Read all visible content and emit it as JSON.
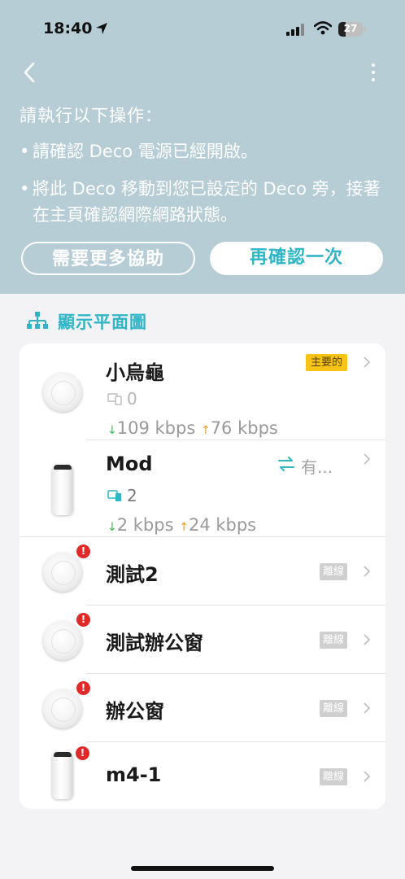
{
  "status_bar": {
    "time": "18:40",
    "battery": "27"
  },
  "header": {
    "back_icon": "chevron-left-icon",
    "menu_icon": "more-vertical-icon"
  },
  "instructions": {
    "title": "請執行以下操作：",
    "bullets": [
      "請確認 Deco 電源已經開啟。",
      "將此 Deco 移動到您已設定的 Deco 旁，接著在主頁確認網際網路狀態。"
    ],
    "bullet_marker": "•"
  },
  "buttons": {
    "help": "需要更多協助",
    "retry": "再確認一次"
  },
  "floorplan": {
    "label": "顯示平面圖",
    "icon": "network-tree-icon"
  },
  "devices": [
    {
      "name": "小烏龜",
      "badge": "主要的",
      "clients": "0",
      "down": "109 kbps",
      "up": "76 kbps",
      "type": "round",
      "online": true
    },
    {
      "name": "Mod",
      "status": "有...",
      "clients": "2",
      "down": "2 kbps",
      "up": "24 kbps",
      "type": "tower",
      "online": true
    },
    {
      "name": "測試2",
      "badge": "離線",
      "type": "round",
      "online": false
    },
    {
      "name": "測試辦公窗",
      "badge": "離線",
      "type": "round",
      "online": false
    },
    {
      "name": "辦公窗",
      "badge": "離線",
      "type": "round",
      "online": false
    },
    {
      "name": "m4-1",
      "badge": "離線",
      "type": "tower",
      "online": false
    }
  ],
  "symbols": {
    "down_arrow": "↓",
    "up_arrow": "↑",
    "alert": "!"
  },
  "colors": {
    "header_bg": "#b6cdd6",
    "accent": "#2fb5c6",
    "main_badge": "#f7c315",
    "offline_badge": "#cfcfcf",
    "alert": "#e02a2a",
    "down": "#3dbb5b",
    "up": "#f29a2e"
  }
}
